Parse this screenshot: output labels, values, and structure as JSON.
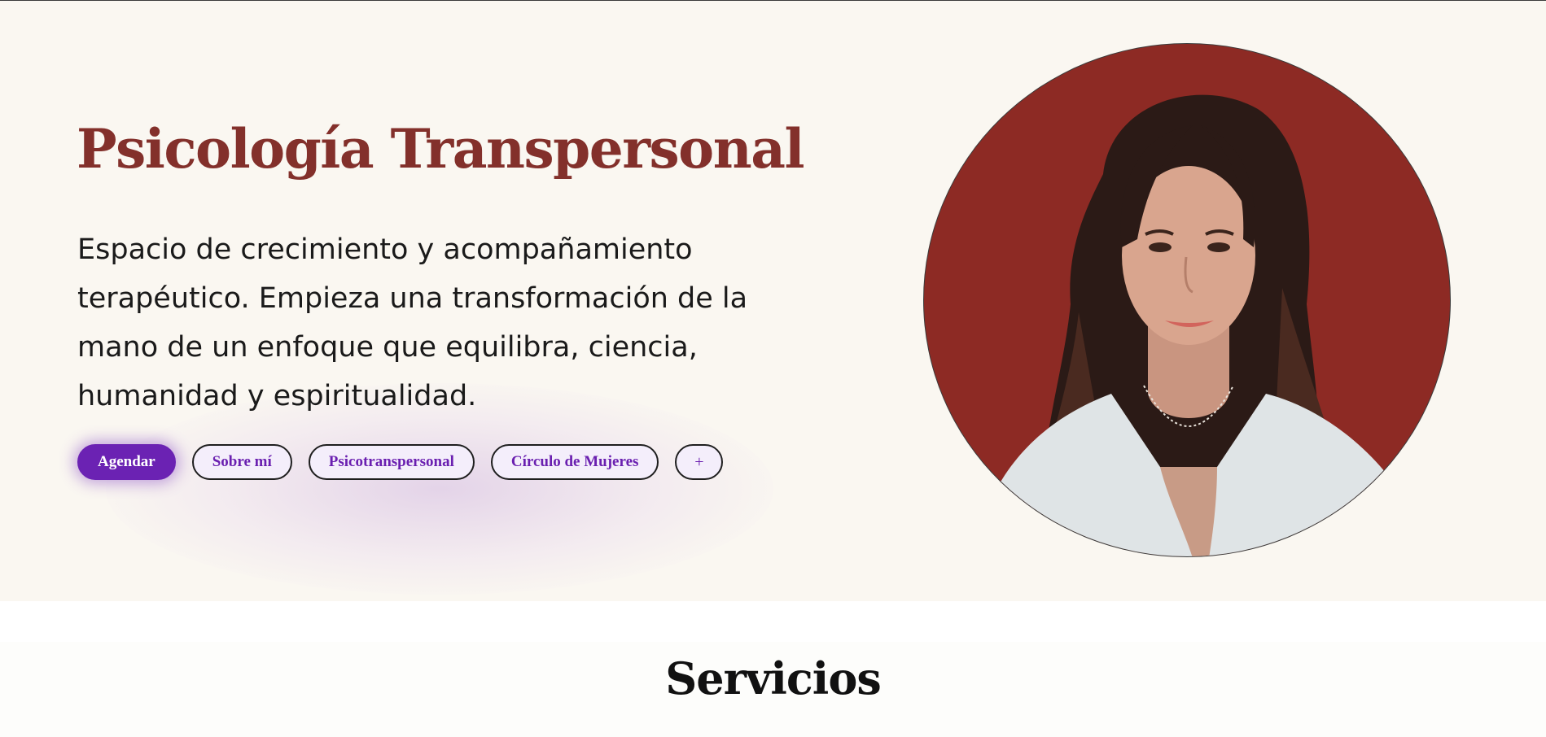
{
  "hero": {
    "title": "Psicología Transpersonal",
    "description": "Espacio de crecimiento y acompañamiento terapéutico. Empieza una transformación de la mano de un enfoque que equilibra, ciencia, humanidad y espiritualidad.",
    "buttons": {
      "agendar": "Agendar",
      "sobre_mi": "Sobre mí",
      "psicotranspersonal": "Psicotranspersonal",
      "circulo": "Círculo de Mujeres",
      "more": "+"
    },
    "portrait_background": "#8d2a24"
  },
  "services": {
    "heading": "Servicios"
  },
  "colors": {
    "title": "#83302b",
    "accent": "#6b22b3",
    "hero_background": "#faf7f1"
  }
}
